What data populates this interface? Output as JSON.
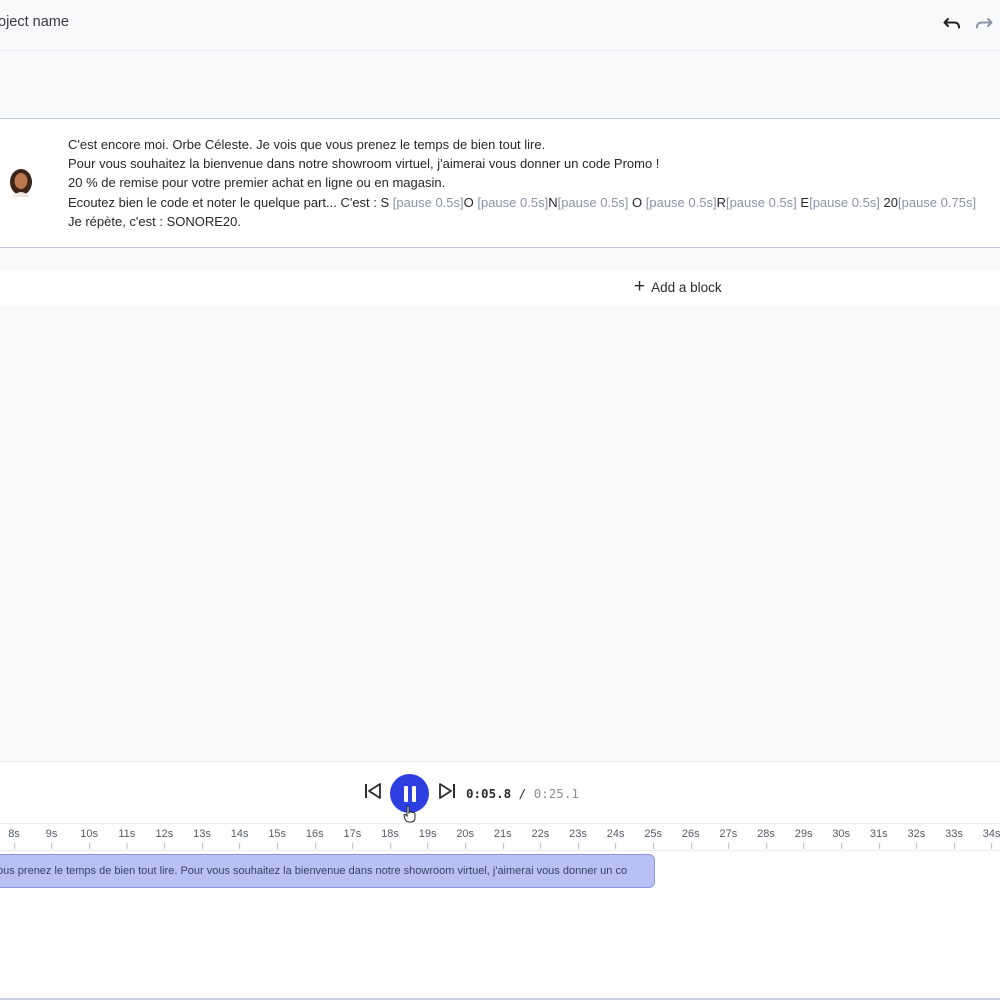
{
  "header": {
    "project_name": "oject name",
    "undo_icon": "undo-icon",
    "redo_icon": "redo-icon"
  },
  "script_block": {
    "avatar_icon": "avatar-woman",
    "lines": [
      "C'est encore moi. Orbe Céleste. Je vois que vous prenez le temps de bien tout lire.",
      "Pour vous souhaitez la bienvenue dans notre showroom virtuel, j'aimerai vous donner un code Promo !",
      "20 % de remise pour votre premier achat en ligne ou en magasin."
    ],
    "line4": {
      "prefix": "Ecoutez bien le code et noter le quelque part... C'est : S ",
      "p1": "[pause 0.5s]",
      "t1": "O ",
      "p2": "[pause 0.5s]",
      "t2": "N",
      "p3": "[pause 0.5s]",
      "t3": " O ",
      "p4": "[pause 0.5s]",
      "t4": "R",
      "p5": "[pause 0.5s]",
      "t5": " E",
      "p6": "[pause 0.5s]",
      "t6": " 20",
      "p7": "[pause 0.75s]"
    },
    "line5": "Je répète, c'est : SONORE20."
  },
  "add_block": {
    "label": "Add a block",
    "icon": "plus-icon"
  },
  "player": {
    "time_current": "0:05.8",
    "time_separator": " / ",
    "time_total": "0:25.1",
    "accent_color": "#2d3fe0",
    "ticks": [
      "8s",
      "9s",
      "10s",
      "11s",
      "12s",
      "13s",
      "14s",
      "15s",
      "16s",
      "17s",
      "18s",
      "19s",
      "20s",
      "21s",
      "22s",
      "23s",
      "24s",
      "25s",
      "26s",
      "27s",
      "28s",
      "29s",
      "30s",
      "31s",
      "32s",
      "33s",
      "34s"
    ],
    "clip_text": "ous prenez le temps de bien tout lire. Pour vous souhaitez la bienvenue dans notre showroom virtuel, j'aimerai vous donner un co"
  }
}
